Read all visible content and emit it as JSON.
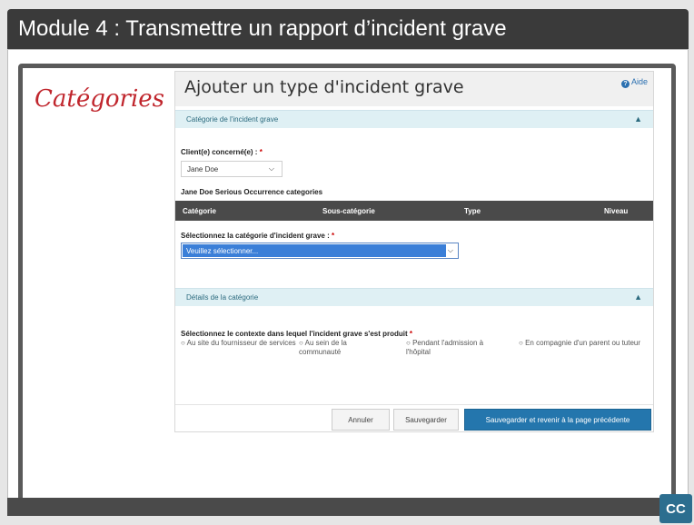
{
  "slide": {
    "title": "Module 4 : Transmettre un rapport d’incident grave",
    "side_heading": "Catégories",
    "cc_label": "CC"
  },
  "form": {
    "title": "Ajouter un type d'incident grave",
    "help_label": "Aide",
    "section1": {
      "label": "Catégorie de l'incident grave",
      "chevron": "▲"
    },
    "client_label": "Client(e) concerné(e) : ",
    "required_mark": "*",
    "client_value": "Jane Doe",
    "categories_heading": "Jane Doe Serious Occurrence categories",
    "table_headers": [
      "Catégorie",
      "Sous-catégorie",
      "Type",
      "Niveau"
    ],
    "select_category_label": "Sélectionnez la catégorie d'incident grave : ",
    "select_category_value": "Veuillez sélectionner...",
    "section2": {
      "label": "Détails de la catégorie",
      "chevron": "▲"
    },
    "context_label": "Sélectionnez le contexte dans lequel l'incident grave s'est produit ",
    "context_options": [
      "Au site du fournisseur de services",
      "Au sein de la communauté",
      "Pendant l'admission à l'hôpital",
      "En compagnie d'un parent ou tuteur"
    ],
    "buttons": {
      "cancel": "Annuler",
      "save": "Sauvegarder",
      "save_return": "Sauvegarder et revenir à la page précédente"
    }
  },
  "colors": {
    "title_bar": "#3a3a3a",
    "accent": "#2476ad",
    "section_bg": "#dff0f4",
    "heading_red": "#c0262d"
  }
}
